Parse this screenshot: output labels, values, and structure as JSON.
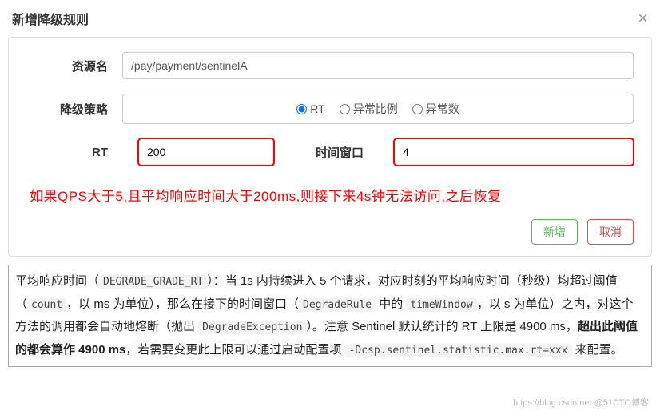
{
  "header": {
    "title": "新增降级规则"
  },
  "form": {
    "resource_label": "资源名",
    "resource_value": "/pay/payment/sentinelA",
    "strategy_label": "降级策略",
    "strategy_options": {
      "rt": "RT",
      "error_ratio": "异常比例",
      "error_count": "异常数"
    },
    "rt_label": "RT",
    "rt_value": "200",
    "window_label": "时间窗口",
    "window_value": "4"
  },
  "note": "如果QPS大于5,且平均响应时间大于200ms,则接下来4s钟无法访问,之后恢复",
  "buttons": {
    "add": "新增",
    "cancel": "取消"
  },
  "desc": {
    "t1": "平均响应时间（",
    "c1": "DEGRADE_GRADE_RT",
    "t2": "）：当 1s 内持续进入 5 个请求，对应时刻的平均响应时间（秒级）均超过阈值（",
    "c2": "count",
    "t3": "，以 ms 为单位），那么在接下的时间窗口（",
    "c3": "DegradeRule",
    "t4": " 中的 ",
    "c4": "timeWindow",
    "t5": "，以 s 为单位）之内，对这个方法的调用都会自动地熔断（抛出 ",
    "c5": "DegradeException",
    "t6": "）。注意 Sentinel 默认统计的 RT 上限是 4900 ms，",
    "bold": "超出此阈值的都会算作 4900 ms",
    "t7": "，若需要变更此上限可以通过启动配置项 ",
    "c6": "-Dcsp.sentinel.statistic.max.rt=xxx",
    "t8": " 来配置。"
  },
  "watermark": "https://blog.csdn.net @51CTO博客"
}
